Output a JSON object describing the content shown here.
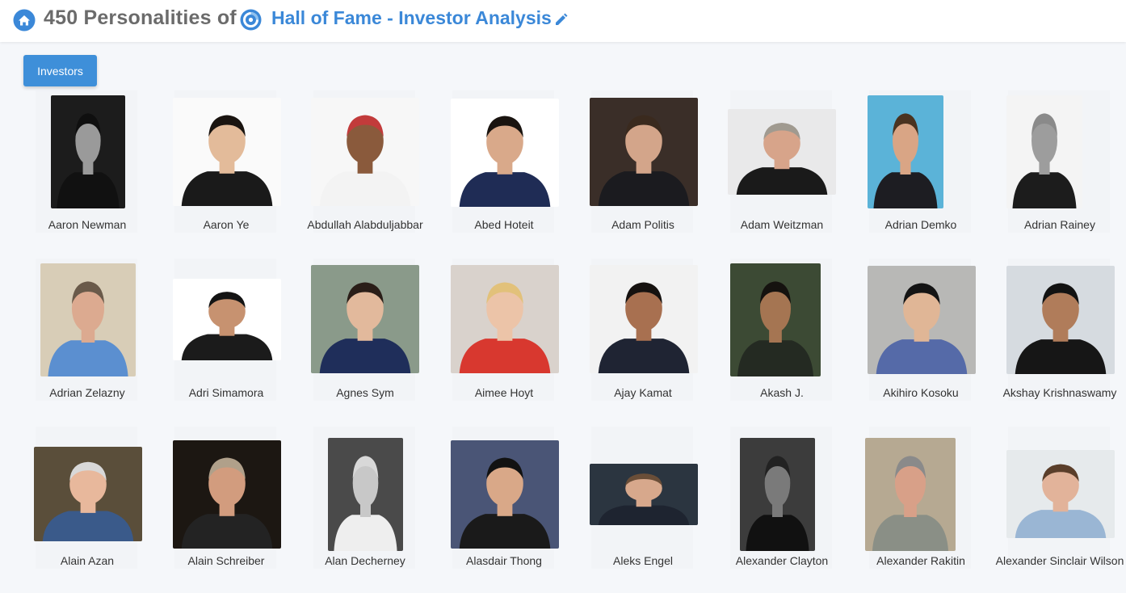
{
  "header": {
    "count_title": "450 Personalities of",
    "project_title": "Hall of Fame - Investor Analysis"
  },
  "tab": {
    "label": "Investors"
  },
  "colors": {
    "accent": "#3e8fd9",
    "title_blue": "#3b88d8"
  },
  "icons": [
    "home-icon",
    "app-logo-icon",
    "pencil-edit-icon"
  ],
  "people": [
    {
      "name": "Aaron Newman",
      "bg": "#1c1c1c",
      "skin": "#9a9a9a",
      "shirt": "#111111",
      "hair": "#0f0f0f"
    },
    {
      "name": "Aaron Ye",
      "bg": "#fafafa",
      "skin": "#e3bb9a",
      "shirt": "#1a1a1a",
      "hair": "#1a1410"
    },
    {
      "name": "Abdullah Alabduljabbar",
      "bg": "#f7f7f7",
      "skin": "#8a5a3c",
      "shirt": "#f3f3f3",
      "hair": "#c23b3b"
    },
    {
      "name": "Abed Hoteit",
      "bg": "#ffffff",
      "skin": "#d9a98a",
      "shirt": "#1f2c55",
      "hair": "#1a1410"
    },
    {
      "name": "Adam Politis",
      "bg": "#3a2e28",
      "skin": "#d3a58a",
      "shirt": "#1b1b1f",
      "hair": "#3a2a1e"
    },
    {
      "name": "Adam Weitzman",
      "bg": "#e9e9ea",
      "skin": "#d7a48a",
      "shirt": "#1a1a1a",
      "hair": "#a09a90"
    },
    {
      "name": "Adrian Demko",
      "bg": "#5bb3d8",
      "skin": "#d9a585",
      "shirt": "#1d1d22",
      "hair": "#4a3320"
    },
    {
      "name": "Adrian Rainey",
      "bg": "#f4f4f4",
      "skin": "#9d9d9d",
      "shirt": "#1c1c1c",
      "hair": "#8a8a8a"
    },
    {
      "name": "Adrian Zelazny",
      "bg": "#d8cdb7",
      "skin": "#dcaa90",
      "shirt": "#5b8fd0",
      "hair": "#6a5a4a"
    },
    {
      "name": "Adri Simamora",
      "bg": "#ffffff",
      "skin": "#c79270",
      "shirt": "#1b1b1b",
      "hair": "#141414"
    },
    {
      "name": "Agnes Sym",
      "bg": "#8a9a8a",
      "skin": "#e2b99c",
      "shirt": "#1f2e5a",
      "hair": "#2a1e18"
    },
    {
      "name": "Aimee Hoyt",
      "bg": "#d9d2cc",
      "skin": "#ecc4a8",
      "shirt": "#d8382f",
      "hair": "#e2c17a"
    },
    {
      "name": "Ajay Kamat",
      "bg": "#f2f2f2",
      "skin": "#a87050",
      "shirt": "#1f2433",
      "hair": "#161210"
    },
    {
      "name": "Akash J.",
      "bg": "#3c4a34",
      "skin": "#a57552",
      "shirt": "#242a22",
      "hair": "#15120f"
    },
    {
      "name": "Akihiro Kosoku",
      "bg": "#b8b8b6",
      "skin": "#e0b696",
      "shirt": "#556aa8",
      "hair": "#141414"
    },
    {
      "name": "Akshay Krishnaswamy",
      "bg": "#d6dbe0",
      "skin": "#b07c5a",
      "shirt": "#161616",
      "hair": "#121212"
    },
    {
      "name": "Alain Azan",
      "bg": "#5a4e3a",
      "skin": "#e8b89c",
      "shirt": "#3a5a8a",
      "hair": "#d8d8d8"
    },
    {
      "name": "Alain Schreiber",
      "bg": "#1c1712",
      "skin": "#d29c7e",
      "shirt": "#232323",
      "hair": "#b0a08a"
    },
    {
      "name": "Alan Decherney",
      "bg": "#4a4a4a",
      "skin": "#c8c8c8",
      "shirt": "#eeeeee",
      "hair": "#d8d8d8"
    },
    {
      "name": "Alasdair Thong",
      "bg": "#4a5576",
      "skin": "#d9a888",
      "shirt": "#1a1a1a",
      "hair": "#121212"
    },
    {
      "name": "Aleks Engel",
      "bg": "#2b3540",
      "skin": "#d7a88c",
      "shirt": "#1e2430",
      "hair": "#6a4e38"
    },
    {
      "name": "Alexander Clayton",
      "bg": "#3c3c3c",
      "skin": "#7a7a7a",
      "shirt": "#111111",
      "hair": "#222222"
    },
    {
      "name": "Alexander Rakitin",
      "bg": "#b6a992",
      "skin": "#d8a088",
      "shirt": "#8a8f86",
      "hair": "#8a8a8a"
    },
    {
      "name": "Alexander Sinclair Wilson",
      "bg": "#e6eaec",
      "skin": "#e2b39a",
      "shirt": "#9ab6d4",
      "hair": "#5a3e2a"
    }
  ]
}
